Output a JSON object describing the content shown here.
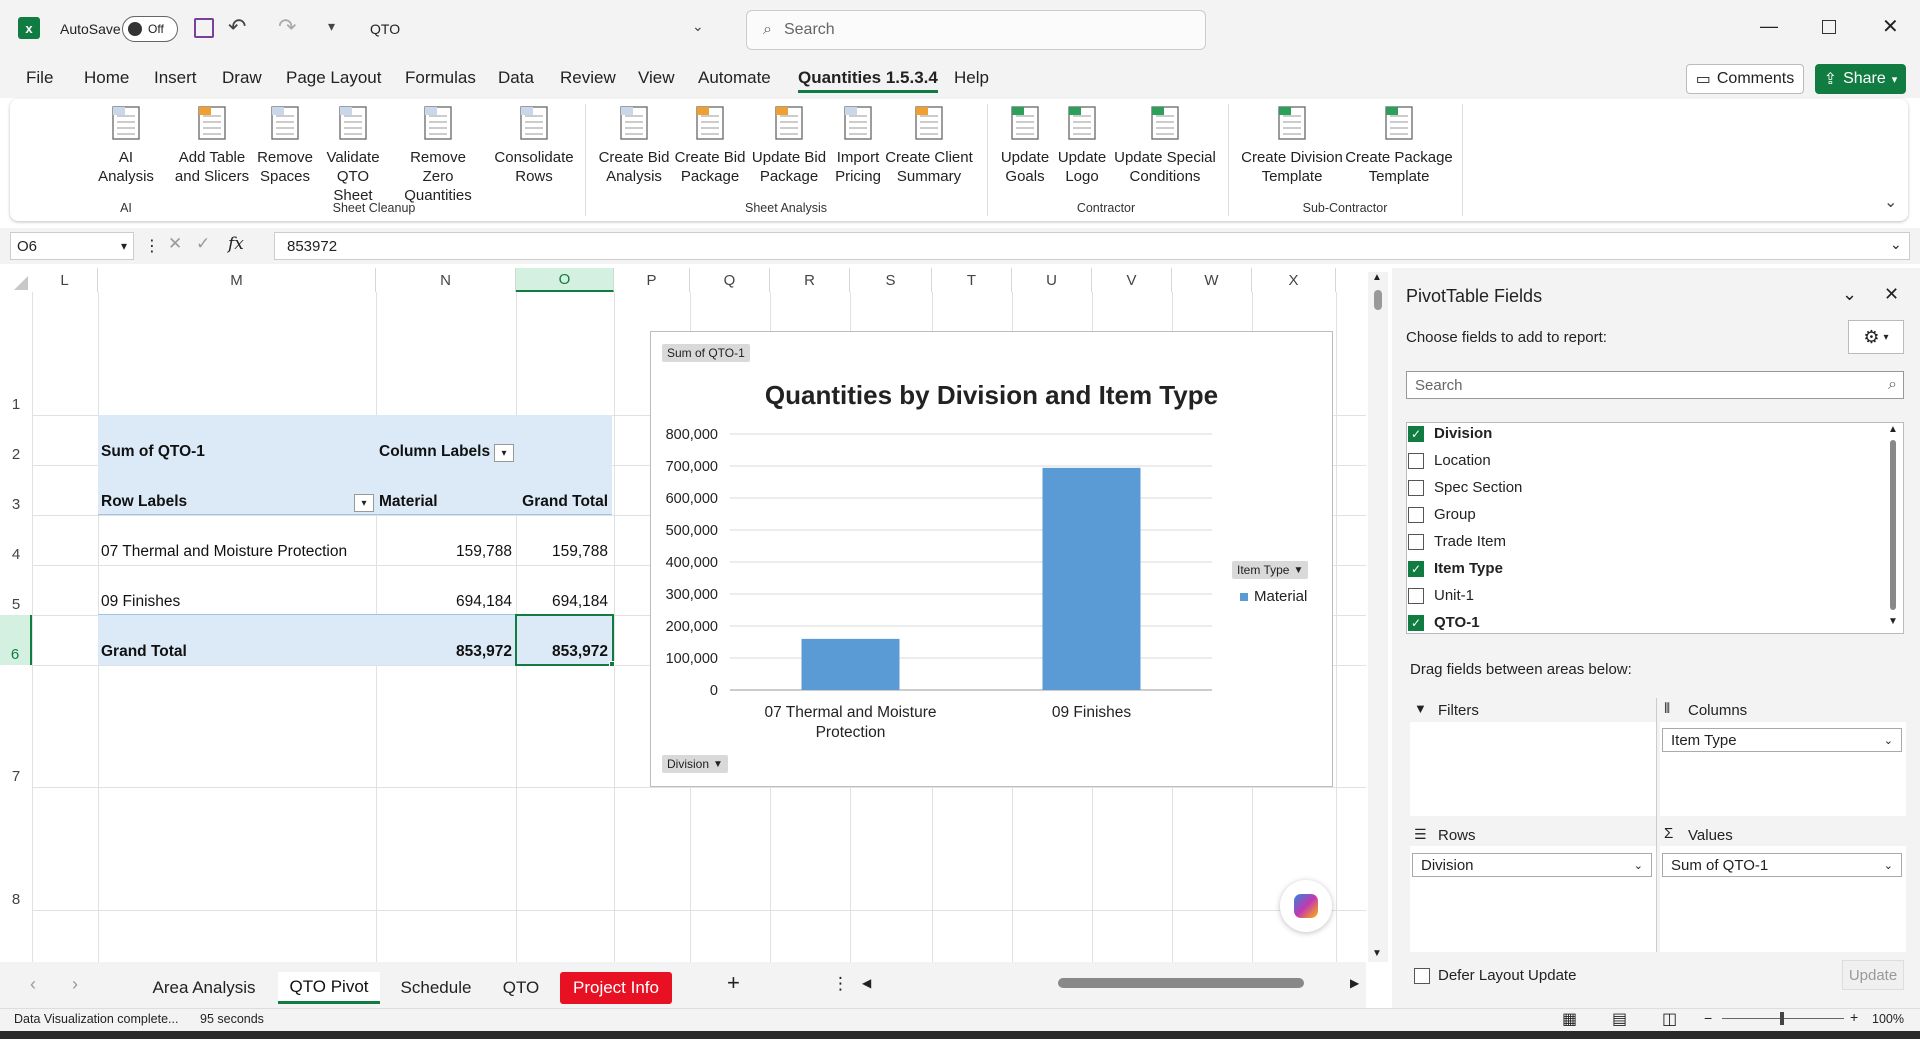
{
  "titlebar": {
    "autosave_label": "AutoSave",
    "autosave_state": "Off",
    "filename": "QTO",
    "search_placeholder": "Search"
  },
  "menu": {
    "items": [
      "File",
      "Home",
      "Insert",
      "Draw",
      "Page Layout",
      "Formulas",
      "Data",
      "Review",
      "View",
      "Automate",
      "Quantities 1.5.3.4",
      "Help"
    ],
    "active": "Quantities 1.5.3.4",
    "comments": "Comments",
    "share": "Share"
  },
  "ribbon": {
    "buttons": [
      {
        "l1": "AI",
        "l2": "Analysis"
      },
      {
        "l1": "Add Table",
        "l2": "and Slicers"
      },
      {
        "l1": "Remove",
        "l2": "Spaces"
      },
      {
        "l1": "Validate",
        "l2": "QTO Sheet"
      },
      {
        "l1": "Remove Zero",
        "l2": "Quantities"
      },
      {
        "l1": "Consolidate",
        "l2": "Rows"
      },
      {
        "l1": "Create Bid",
        "l2": "Analysis"
      },
      {
        "l1": "Create Bid",
        "l2": "Package"
      },
      {
        "l1": "Update Bid",
        "l2": "Package"
      },
      {
        "l1": "Import",
        "l2": "Pricing"
      },
      {
        "l1": "Create Client",
        "l2": "Summary"
      },
      {
        "l1": "Update",
        "l2": "Goals"
      },
      {
        "l1": "Update",
        "l2": "Logo"
      },
      {
        "l1": "Update Special",
        "l2": "Conditions"
      },
      {
        "l1": "Create Division",
        "l2": "Template"
      },
      {
        "l1": "Create Package",
        "l2": "Template"
      }
    ],
    "groups": [
      "AI",
      "Sheet Cleanup",
      "Sheet Analysis",
      "Contractor",
      "Sub-Contractor"
    ]
  },
  "formula_bar": {
    "name_box": "O6",
    "fx": "fx",
    "value": "853972"
  },
  "grid": {
    "columns": [
      "L",
      "M",
      "N",
      "O",
      "P",
      "Q",
      "R",
      "S",
      "T",
      "U",
      "V",
      "W",
      "X"
    ],
    "rows": [
      "1",
      "2",
      "3",
      "4",
      "5",
      "6",
      "7",
      "8"
    ]
  },
  "pivot": {
    "sum_label": "Sum of QTO-1",
    "column_labels": "Column Labels",
    "row_labels": "Row Labels",
    "material": "Material",
    "grand_total": "Grand Total",
    "rows": [
      {
        "label": "07 Thermal and Moisture Protection",
        "material": "159,788",
        "total": "159,788"
      },
      {
        "label": "09 Finishes",
        "material": "694,184",
        "total": "694,184"
      }
    ],
    "grand_row": {
      "label": "Grand Total",
      "material": "853,972",
      "total": "853,972"
    }
  },
  "chart_data": {
    "type": "bar",
    "title": "Quantities by Division and Item Type",
    "categories": [
      "07 Thermal and Moisture Protection",
      "09 Finishes"
    ],
    "series": [
      {
        "name": "Material",
        "values": [
          159788,
          694184
        ]
      }
    ],
    "yticks": [
      "0",
      "100,000",
      "200,000",
      "300,000",
      "400,000",
      "500,000",
      "600,000",
      "700,000",
      "800,000"
    ],
    "ylim": [
      0,
      800000
    ],
    "grid": true,
    "legend": "right",
    "color": "#5b9bd5",
    "value_button": "Sum of QTO-1",
    "legend_button": "Item Type",
    "axis_button": "Division",
    "cat_line1": [
      "07 Thermal and Moisture",
      "09 Finishes"
    ],
    "cat_line2": [
      "Protection",
      ""
    ]
  },
  "pane": {
    "title": "PivotTable Fields",
    "subtitle": "Choose fields to add to report:",
    "search_placeholder": "Search",
    "fields": [
      {
        "name": "Division",
        "checked": true
      },
      {
        "name": "Location",
        "checked": false
      },
      {
        "name": "Spec Section",
        "checked": false
      },
      {
        "name": "Group",
        "checked": false
      },
      {
        "name": "Trade Item",
        "checked": false
      },
      {
        "name": "Item Type",
        "checked": true
      },
      {
        "name": "Unit-1",
        "checked": false
      },
      {
        "name": "QTO-1",
        "checked": true
      }
    ],
    "drag_label": "Drag fields between areas below:",
    "filters": "Filters",
    "columns": "Columns",
    "rows": "Rows",
    "values": "Values",
    "columns_value": "Item Type",
    "rows_value": "Division",
    "values_value": "Sum of QTO-1",
    "defer": "Defer Layout Update",
    "update": "Update"
  },
  "tabs": {
    "items": [
      "Area Analysis",
      "QTO Pivot",
      "Schedule",
      "QTO",
      "Project Info"
    ],
    "active": "QTO Pivot",
    "highlight": "Project Info",
    "highlight_color": "#e81123"
  },
  "status": {
    "message": "Data Visualization complete...",
    "time": "95 seconds",
    "zoom": "100%"
  }
}
